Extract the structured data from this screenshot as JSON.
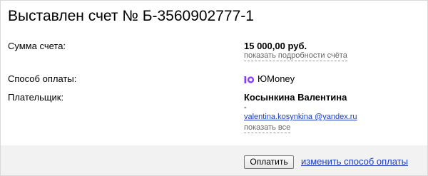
{
  "invoice": {
    "title": "Выставлен счет № Б-3560902777-1"
  },
  "amount": {
    "label": "Сумма счета:",
    "value": "15 000,00 руб.",
    "details_link": "показать подробности счёта"
  },
  "payment_method": {
    "label": "Способ оплаты:",
    "value": "ЮMoney",
    "icon": "yoomoney-icon",
    "icon_color": "#8b3ffd"
  },
  "payer": {
    "label": "Плательщик:",
    "name": "Косынкина Валентина",
    "phone": "-",
    "email": "valentina.kosynkina @yandex.ru",
    "show_all_link": "показать все"
  },
  "footer": {
    "pay_button": "Оплатить",
    "change_method_link": "изменить способ оплаты"
  },
  "colors": {
    "link": "#1a3dc1",
    "footer_bg": "#f2f2f2",
    "border": "#d9d9d9"
  }
}
